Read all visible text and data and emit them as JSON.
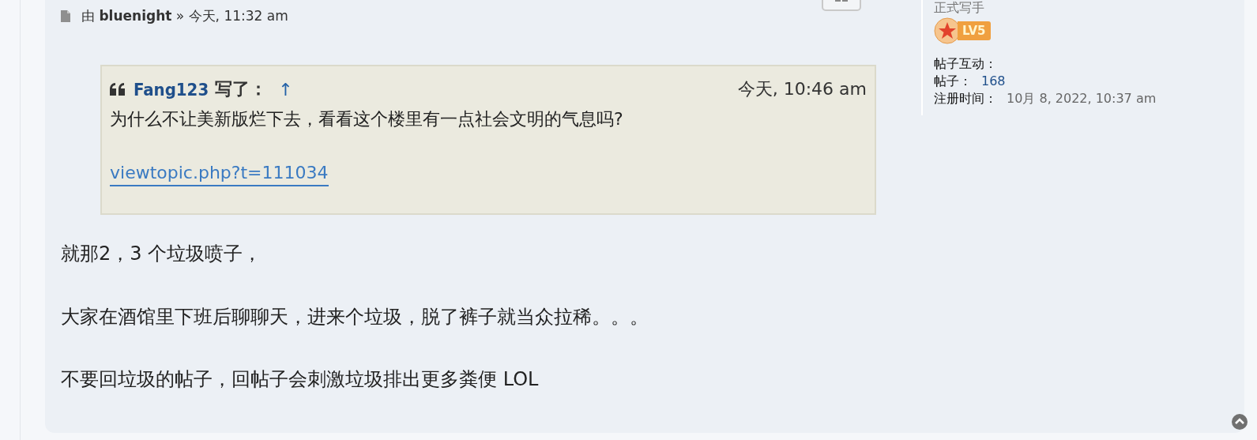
{
  "post": {
    "author_prefix": "由",
    "author": "bluenight",
    "separator": "»",
    "time": "今天, 11:32 am",
    "quote": {
      "author": "Fang123",
      "wrote": "写了：",
      "jump": "↑",
      "time": "今天, 10:46 am",
      "text": "为什么不让美新版烂下去，看看这个楼里有一点社会文明的气息吗?",
      "link": "viewtopic.php?t=111034"
    },
    "paragraphs": [
      "就那2，3 个垃圾喷子，",
      "大家在酒馆里下班后聊聊天，进来个垃圾，脱了裤子就当众拉稀。。。",
      "不要回垃圾的帖子，回帖子会刺激垃圾排出更多粪便 LOL"
    ]
  },
  "profile": {
    "rank": "正式写手",
    "badge": "LV5",
    "interactions_label": "帖子互动：",
    "posts_label": "帖子：",
    "posts": "168",
    "joined_label": "注册时间：",
    "joined": "10月 8, 2022, 10:37 am"
  }
}
